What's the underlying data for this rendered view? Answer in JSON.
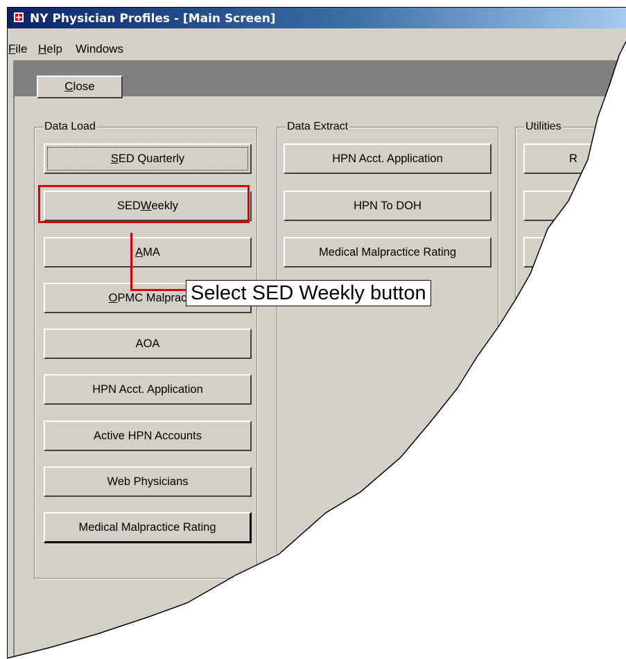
{
  "window": {
    "title": "NY Physician Profiles - [Main Screen]"
  },
  "menu": [
    {
      "pre": "",
      "accel": "F",
      "post": "ile"
    },
    {
      "pre": "",
      "accel": "H",
      "post": "elp"
    },
    {
      "pre": "Windows",
      "accel": "",
      "post": ""
    }
  ],
  "toolbar": {
    "close": {
      "pre": "",
      "accel": "C",
      "post": "lose"
    }
  },
  "groups": {
    "data_load": {
      "label": "Data Load",
      "buttons": [
        {
          "pre": "",
          "accel": "S",
          "post": "ED Quarterly"
        },
        {
          "pre": "SED ",
          "accel": "W",
          "post": "eekly"
        },
        {
          "pre": "",
          "accel": "A",
          "post": "MA"
        },
        {
          "pre": "",
          "accel": "O",
          "post": "PMC Malprac"
        },
        {
          "pre": "AOA",
          "accel": "",
          "post": ""
        },
        {
          "pre": "HPN Acct. Application",
          "accel": "",
          "post": ""
        },
        {
          "pre": "Active HPN Accounts",
          "accel": "",
          "post": ""
        },
        {
          "pre": "Web Physicians",
          "accel": "",
          "post": ""
        },
        {
          "pre": "Medical Malpractice Rating",
          "accel": "",
          "post": ""
        }
      ]
    },
    "data_extract": {
      "label": "Data Extract",
      "buttons": [
        {
          "pre": "HPN Acct. Application",
          "accel": "",
          "post": ""
        },
        {
          "pre": "HPN To DOH",
          "accel": "",
          "post": ""
        },
        {
          "pre": "Medical Malpractice Rating",
          "accel": "",
          "post": ""
        }
      ]
    },
    "utilities": {
      "label": "Utilities",
      "buttons": [
        {
          "pre": "R",
          "accel": "",
          "post": ""
        },
        {
          "pre": "",
          "accel": "",
          "post": ""
        },
        {
          "pre": "",
          "accel": "",
          "post": ""
        }
      ]
    }
  },
  "annotation": {
    "callout": "Select SED Weekly button",
    "color": "#e00000"
  }
}
